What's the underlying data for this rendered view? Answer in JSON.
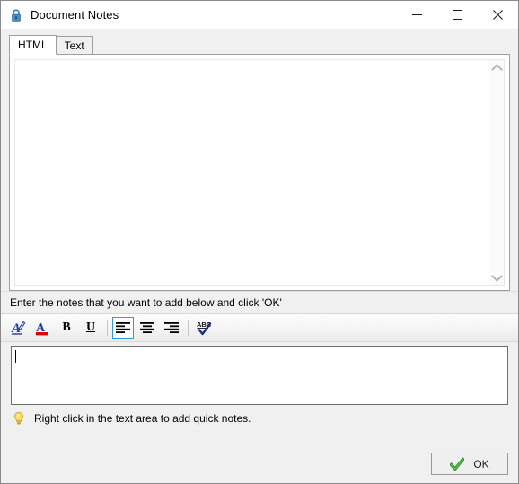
{
  "window": {
    "title": "Document Notes",
    "icon": "lock-icon",
    "controls": {
      "minimize": "minimize-icon",
      "maximize": "maximize-icon",
      "close": "close-icon"
    }
  },
  "tabs": [
    {
      "label": "HTML",
      "active": true
    },
    {
      "label": "Text",
      "active": false
    }
  ],
  "preview": {
    "content": "",
    "scrollbar": {
      "up_arrow": "chevron-up-icon",
      "down_arrow": "chevron-down-icon"
    }
  },
  "instruction": {
    "text": "Enter the notes that you want to add below and click 'OK'"
  },
  "toolbar": {
    "buttons": [
      {
        "name": "font-style-button",
        "icon": "font-pen-icon",
        "tooltip": "Font",
        "selected": false
      },
      {
        "name": "font-color-button",
        "icon": "font-color-icon",
        "tooltip": "Font Color",
        "selected": false
      },
      {
        "name": "bold-button",
        "icon": "bold-icon",
        "label": "B",
        "tooltip": "Bold",
        "selected": false
      },
      {
        "name": "underline-button",
        "icon": "underline-icon",
        "label": "U",
        "tooltip": "Underline",
        "selected": false
      },
      {
        "name": "align-left-button",
        "icon": "align-left-icon",
        "tooltip": "Align Left",
        "selected": true
      },
      {
        "name": "align-center-button",
        "icon": "align-center-icon",
        "tooltip": "Align Center",
        "selected": false
      },
      {
        "name": "align-right-button",
        "icon": "align-right-icon",
        "tooltip": "Align Right",
        "selected": false
      },
      {
        "name": "spell-check-button",
        "icon": "spell-check-icon",
        "tooltip": "Spelling",
        "selected": false
      }
    ]
  },
  "editor": {
    "value": "",
    "placeholder": ""
  },
  "hint": {
    "icon": "lightbulb-icon",
    "text": "Right click in the text area to add quick notes."
  },
  "footer": {
    "ok_label": "OK",
    "ok_icon": "green-check-icon"
  },
  "colors": {
    "accent": "#3399dd",
    "window_bg": "#f0f0f0",
    "content_bg": "#ffffff",
    "font_color_swatch": "#e00000",
    "ok_check": "#3aa233",
    "lock_blue": "#2f6fa8",
    "bulb_yellow": "#f6d34a"
  }
}
